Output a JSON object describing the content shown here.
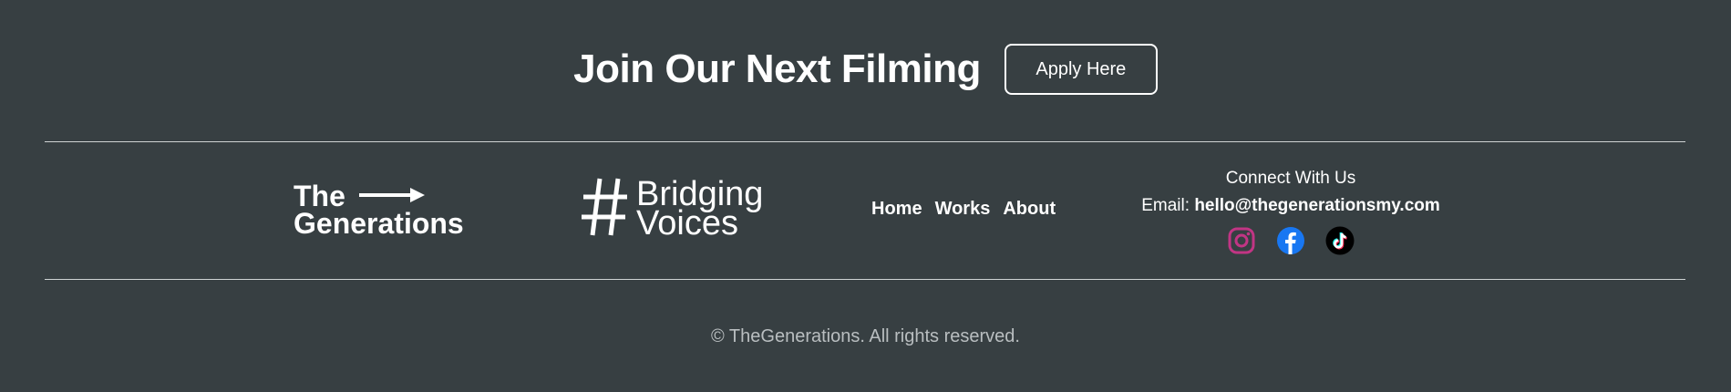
{
  "cta": {
    "title": "Join Our Next Filming",
    "button_label": "Apply Here"
  },
  "logos": {
    "generations": {
      "line1": "The",
      "line2": "Generations"
    },
    "bridging": {
      "word1": "Bridging",
      "word2": "Voices"
    }
  },
  "nav": {
    "items": [
      {
        "label": "Home"
      },
      {
        "label": "Works"
      },
      {
        "label": "About"
      }
    ]
  },
  "connect": {
    "title": "Connect With Us",
    "email_label": "Email:",
    "email": "hello@thegenerationsmy.com",
    "socials": [
      {
        "name": "instagram-icon",
        "color": "#c13584"
      },
      {
        "name": "facebook-icon",
        "color": "#1877f2"
      },
      {
        "name": "tiktok-icon",
        "color": "#000000"
      }
    ]
  },
  "footer": {
    "copyright": "© TheGenerations. All rights reserved."
  }
}
